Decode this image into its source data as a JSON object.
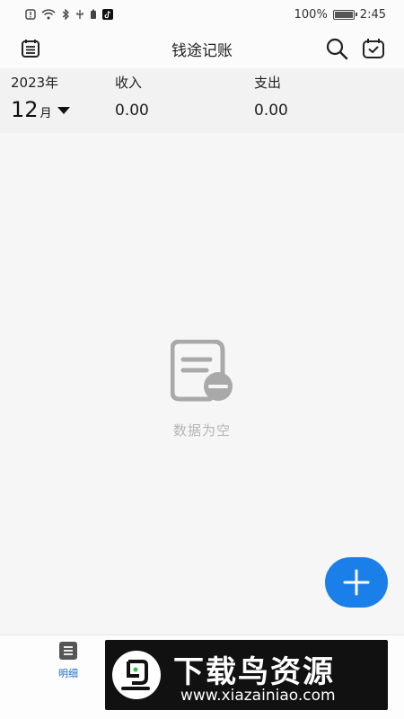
{
  "status_bar": {
    "battery_percent": "100%",
    "time": "2:45"
  },
  "header": {
    "title": "钱途记账",
    "left_icon": "list-icon",
    "right_icons": [
      "search-icon",
      "calendar-check-icon"
    ]
  },
  "summary": {
    "year": "2023年",
    "month_num": "12",
    "month_unit": "月",
    "income_label": "收入",
    "income_value": "0.00",
    "expense_label": "支出",
    "expense_value": "0.00"
  },
  "main": {
    "empty_text": "数据为空"
  },
  "bottom_nav": {
    "items": [
      {
        "label": "明细",
        "icon": "list-icon",
        "active": true
      }
    ]
  },
  "watermark": {
    "title": "下载鸟资源",
    "url": "www.xiazainiao.com"
  },
  "colors": {
    "accent": "#1a7fe8",
    "empty_text": "#b5b5b5"
  }
}
